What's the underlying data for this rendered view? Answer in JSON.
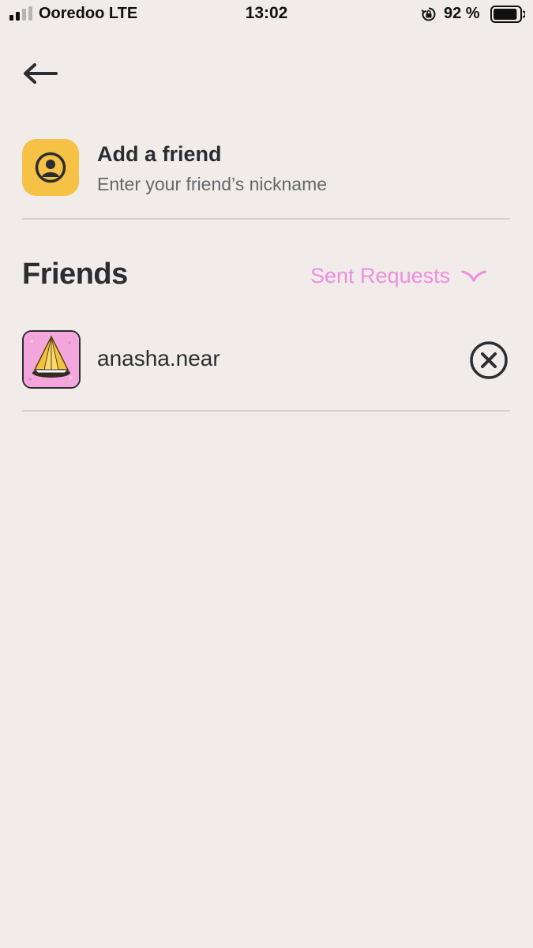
{
  "status_bar": {
    "carrier": "Ooredoo  LTE",
    "time": "13:02",
    "battery_percent": "92 %",
    "battery_level": 0.92
  },
  "nav": {
    "back_icon": "arrow-left-icon"
  },
  "add_friend": {
    "title": "Add a friend",
    "subtitle": "Enter your friend’s nickname",
    "icon": "user-circle-icon",
    "tile_color": "#f5c245"
  },
  "friends": {
    "title": "Friends",
    "sent_requests_label": "Sent Requests",
    "sent_requests_color": "#ee8fdc",
    "items": [
      {
        "name": "anasha.near",
        "avatar_icon": "yellow-crystal-avatar",
        "remove_icon": "close-circle-icon"
      }
    ]
  }
}
